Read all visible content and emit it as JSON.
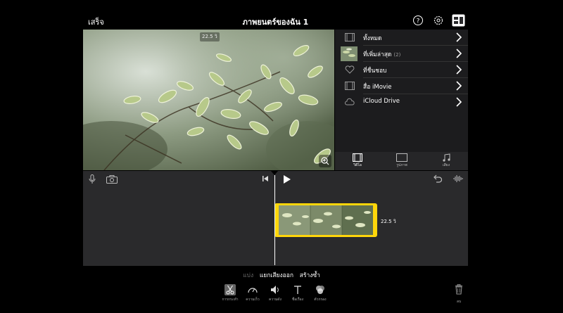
{
  "topbar": {
    "done_label": "เสร็จ",
    "title": "ภาพยนตร์ของฉัน 1",
    "icons": [
      "help-icon",
      "settings-icon",
      "media-browser-toggle-icon"
    ]
  },
  "viewer": {
    "duration_badge": "22.5 วิ",
    "zoom_icon": "zoom-icon"
  },
  "browser": {
    "items": [
      {
        "label": "ทั้งหมด",
        "count": "",
        "icon": "film-icon"
      },
      {
        "label": "ที่เพิ่มล่าสุด",
        "count": "(2)",
        "icon": "thumbnail"
      },
      {
        "label": "ที่ชื่นชอบ",
        "count": "",
        "icon": "heart-icon"
      },
      {
        "label": "สื่อ iMovie",
        "count": "",
        "icon": "film-icon"
      },
      {
        "label": "iCloud Drive",
        "count": "",
        "icon": "cloud-icon"
      }
    ],
    "tabs": [
      {
        "label": "วิดีโอ",
        "icon": "video-icon",
        "active": true
      },
      {
        "label": "รูปภาพ",
        "icon": "photo-icon",
        "active": false
      },
      {
        "label": "เสียง",
        "icon": "music-icon",
        "active": false
      }
    ]
  },
  "timeline": {
    "clip_duration": "22.5 วิ",
    "icons": [
      "microphone-icon",
      "camera-icon",
      "skip-to-start-icon",
      "play-icon",
      "undo-icon",
      "audio-waveform-icon"
    ]
  },
  "edit_actions": {
    "split": "แบ่ง",
    "detach_audio": "แยกเสียงออก",
    "duplicate": "สร้างซ้ำ"
  },
  "tools": [
    {
      "label": "การกระทำ",
      "icon": "scissors-icon",
      "active": true
    },
    {
      "label": "ความเร็ว",
      "icon": "speedometer-icon",
      "active": false
    },
    {
      "label": "ความดัง",
      "icon": "volume-icon",
      "active": false
    },
    {
      "label": "ชื่อเรื่อง",
      "icon": "title-text-icon",
      "active": false
    },
    {
      "label": "ตัวกรอง",
      "icon": "filters-icon",
      "active": false
    }
  ],
  "delete_label": "ลบ",
  "colors": {
    "clip_border": "#ffd60a",
    "timeline_bg": "#2a2a2c",
    "browser_bg": "#1c1c1e"
  }
}
